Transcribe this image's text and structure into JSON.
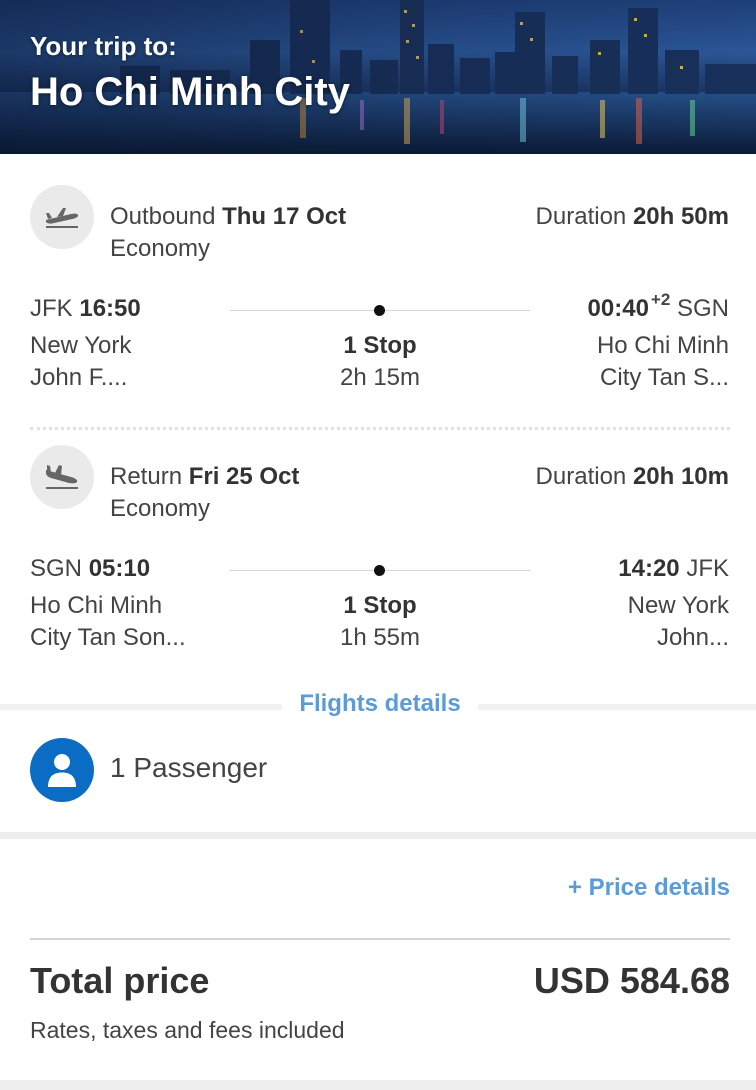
{
  "header": {
    "pretitle": "Your trip to:",
    "city": "Ho Chi Minh City"
  },
  "outbound": {
    "icon": "plane-takeoff-icon",
    "label": "Outbound",
    "date": "Thu 17 Oct",
    "cabin": "Economy",
    "duration_label": "Duration",
    "duration": "20h 50m",
    "depart_code": "JFK",
    "depart_time": "16:50",
    "depart_city": "New York",
    "depart_airport": "John F....",
    "stops": "1 Stop",
    "stop_duration": "2h 15m",
    "arrive_time": "00:40",
    "arrive_day_offset": "+2",
    "arrive_code": "SGN",
    "arrive_city": "Ho Chi Minh",
    "arrive_airport": "City Tan S..."
  },
  "return": {
    "icon": "plane-landing-icon",
    "label": "Return",
    "date": "Fri 25 Oct",
    "cabin": "Economy",
    "duration_label": "Duration",
    "duration": "20h 10m",
    "depart_code": "SGN",
    "depart_time": "05:10",
    "depart_city": "Ho Chi Minh",
    "depart_airport": "City Tan Son...",
    "stops": "1 Stop",
    "stop_duration": "1h 55m",
    "arrive_time": "14:20",
    "arrive_code": "JFK",
    "arrive_city": "New York",
    "arrive_airport": "John..."
  },
  "flights_details_link": "Flights details",
  "passengers": {
    "icon": "user-icon",
    "label": "1 Passenger"
  },
  "price": {
    "details_link": "+ Price details",
    "total_label": "Total price",
    "total_value": "USD 584.68",
    "fees_note": "Rates, taxes and fees included"
  },
  "colors": {
    "link": "#5b9bd8",
    "avatar": "#0b6cc4",
    "icon_bg": "#eaeaea",
    "text": "#333333"
  }
}
